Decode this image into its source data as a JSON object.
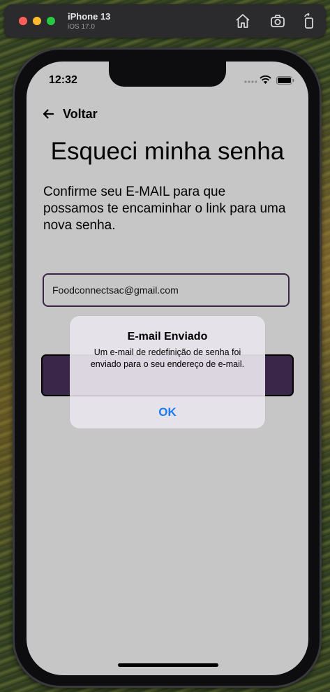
{
  "simulator": {
    "device_name": "iPhone 13",
    "os_version": "iOS 17.0",
    "toolbar_icons": [
      "home-icon",
      "screenshot-icon",
      "rotate-icon"
    ]
  },
  "status_bar": {
    "time": "12:32",
    "icons": [
      "signal-icon",
      "wifi-icon",
      "battery-icon"
    ]
  },
  "nav": {
    "back_label": "Voltar",
    "back_icon": "arrow-left-icon"
  },
  "page": {
    "title": "Esqueci minha senha",
    "description": "Confirme seu E-MAIL para que possamos te encaminhar o link para uma nova senha."
  },
  "form": {
    "email_value": "Foodconnectsac@gmail.com"
  },
  "alert": {
    "title": "E-mail Enviado",
    "message": "Um e-mail de redefinição de senha foi enviado para o seu endereço de e-mail.",
    "ok_label": "OK"
  },
  "colors": {
    "screen_background": "#c6c6c6",
    "accent_purple": "#3a2648",
    "ios_blue": "#1a7cf2"
  }
}
